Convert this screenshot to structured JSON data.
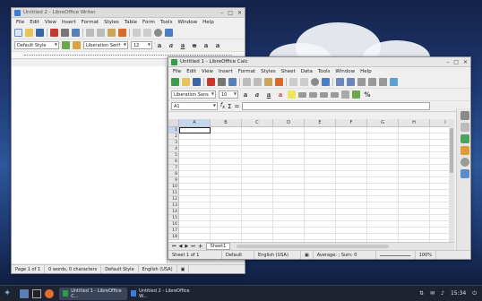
{
  "writer": {
    "title": "Untitled 2 - LibreOffice Writer",
    "menu": [
      "File",
      "Edit",
      "View",
      "Insert",
      "Format",
      "Styles",
      "Table",
      "Form",
      "Tools",
      "Window",
      "Help"
    ],
    "para_style": "Default Style",
    "font_name": "Liberation Serif",
    "font_size": "12",
    "status": {
      "page": "Page 1 of 1",
      "words": "0 words, 0 characters",
      "style": "Default Style",
      "lang": "English (USA)"
    }
  },
  "calc": {
    "title": "Untitled 1 - LibreOffice Calc",
    "menu": [
      "File",
      "Edit",
      "View",
      "Insert",
      "Format",
      "Styles",
      "Sheet",
      "Data",
      "Tools",
      "Window",
      "Help"
    ],
    "font_name": "Liberation Sans",
    "font_size": "10",
    "name_box": "A1",
    "formula_value": "",
    "columns": [
      "A",
      "B",
      "C",
      "D",
      "E",
      "F",
      "G",
      "H",
      "I"
    ],
    "rows": [
      "1",
      "2",
      "3",
      "4",
      "5",
      "6",
      "7",
      "8",
      "9",
      "10",
      "11",
      "12",
      "13",
      "14",
      "15",
      "16",
      "17",
      "18"
    ],
    "sheet_tab": "Sheet1",
    "add_sheet": "+",
    "status": {
      "sheet": "Sheet 1 of 1",
      "style": "Default",
      "lang": "English (USA)",
      "sum": "Average: ; Sum: 0",
      "zoom": "100%"
    }
  },
  "taskbar": {
    "items": [
      "Untitled 1 - LibreOffice C...",
      "Untitled 2 - LibreOffice W..."
    ],
    "clock": "15:34"
  },
  "icons": {
    "start": "kali-dragon-icon",
    "tray": [
      "network-icon",
      "mail-icon",
      "volume-icon",
      "power-icon"
    ]
  }
}
